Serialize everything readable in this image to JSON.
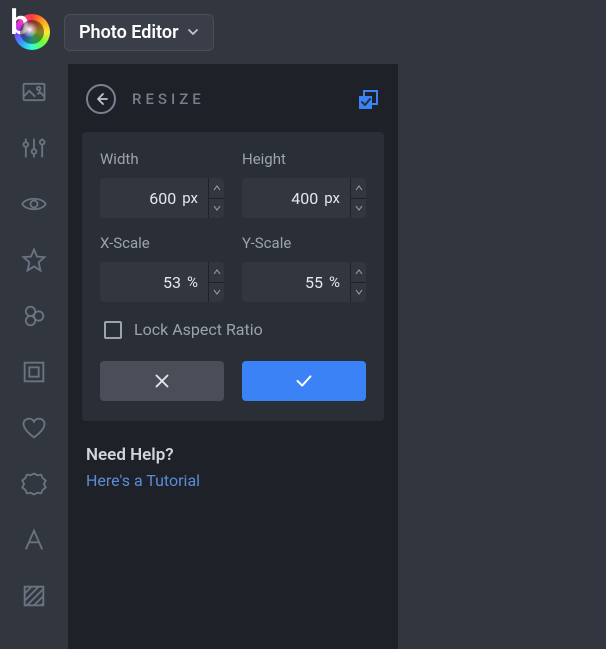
{
  "header": {
    "app_title": "Photo Editor"
  },
  "panel": {
    "title": "RESIZE",
    "width_label": "Width",
    "width_value": "600",
    "width_unit": "px",
    "height_label": "Height",
    "height_value": "400",
    "height_unit": "px",
    "xscale_label": "X-Scale",
    "xscale_value": "53",
    "xscale_unit": "%",
    "yscale_label": "Y-Scale",
    "yscale_value": "55",
    "yscale_unit": "%",
    "lock_label": "Lock Aspect Ratio",
    "lock_checked": false
  },
  "help": {
    "title": "Need Help?",
    "link": "Here's a Tutorial"
  },
  "colors": {
    "accent": "#3b82f6"
  }
}
